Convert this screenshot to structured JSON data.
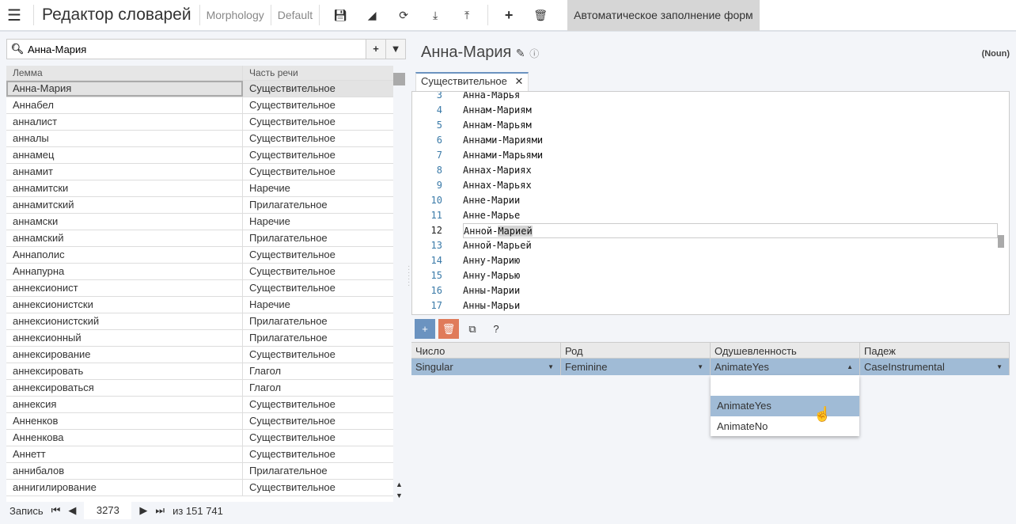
{
  "header": {
    "title": "Редактор словарей",
    "module": "Morphology",
    "profile": "Default",
    "auto_fill": "Автоматическое заполнение форм"
  },
  "search": {
    "value": "Анна-Мария"
  },
  "grid": {
    "columns": [
      "Лемма",
      "Часть речи"
    ],
    "rows": [
      [
        "Анна-Мария",
        "Существительное"
      ],
      [
        "Аннабел",
        "Существительное"
      ],
      [
        "анналист",
        "Существительное"
      ],
      [
        "анналы",
        "Существительное"
      ],
      [
        "аннамец",
        "Существительное"
      ],
      [
        "аннамит",
        "Существительное"
      ],
      [
        "аннамитски",
        "Наречие"
      ],
      [
        "аннамитский",
        "Прилагательное"
      ],
      [
        "аннамски",
        "Наречие"
      ],
      [
        "аннамский",
        "Прилагательное"
      ],
      [
        "Аннаполис",
        "Существительное"
      ],
      [
        "Аннапурна",
        "Существительное"
      ],
      [
        "аннексионист",
        "Существительное"
      ],
      [
        "аннексионистски",
        "Наречие"
      ],
      [
        "аннексионистский",
        "Прилагательное"
      ],
      [
        "аннексионный",
        "Прилагательное"
      ],
      [
        "аннексирование",
        "Существительное"
      ],
      [
        "аннексировать",
        "Глагол"
      ],
      [
        "аннексироваться",
        "Глагол"
      ],
      [
        "аннексия",
        "Существительное"
      ],
      [
        "Анненков",
        "Существительное"
      ],
      [
        "Анненкова",
        "Существительное"
      ],
      [
        "Аннетт",
        "Существительное"
      ],
      [
        "аннибалов",
        "Прилагательное"
      ],
      [
        "аннигилирование",
        "Существительное"
      ]
    ]
  },
  "pager": {
    "label": "Запись",
    "current": "3273",
    "total": "из 151 741"
  },
  "detail": {
    "lemma": "Анна-Мария",
    "pos_tag": "(Noun)",
    "tab": "Существительное"
  },
  "editor": {
    "lines": [
      [
        "3",
        "Анна-Марья"
      ],
      [
        "4",
        "Аннам-Мариям"
      ],
      [
        "5",
        "Аннам-Марьям"
      ],
      [
        "6",
        "Аннами-Мариями"
      ],
      [
        "7",
        "Аннами-Марьями"
      ],
      [
        "8",
        "Аннах-Мариях"
      ],
      [
        "9",
        "Аннах-Марьях"
      ],
      [
        "10",
        "Анне-Марии"
      ],
      [
        "11",
        "Анне-Марье"
      ],
      [
        "12",
        "Анной-Марией"
      ],
      [
        "13",
        "Анной-Марьей"
      ],
      [
        "14",
        "Анну-Марию"
      ],
      [
        "15",
        "Анну-Марью"
      ],
      [
        "16",
        "Анны-Марии"
      ],
      [
        "17",
        "Анны-Марьи"
      ]
    ],
    "current_line": "12"
  },
  "features": {
    "columns": [
      "Число",
      "Род",
      "Одушевленность",
      "Падеж"
    ],
    "values": [
      "Singular",
      "Feminine",
      "AnimateYes",
      "CaseInstrumental"
    ],
    "dropdown_options": [
      "",
      "AnimateYes",
      "AnimateNo"
    ],
    "help": "?"
  },
  "colors": {
    "accent": "#6b93c0",
    "delete": "#e07b5a",
    "selected": "#a0bbd6"
  }
}
